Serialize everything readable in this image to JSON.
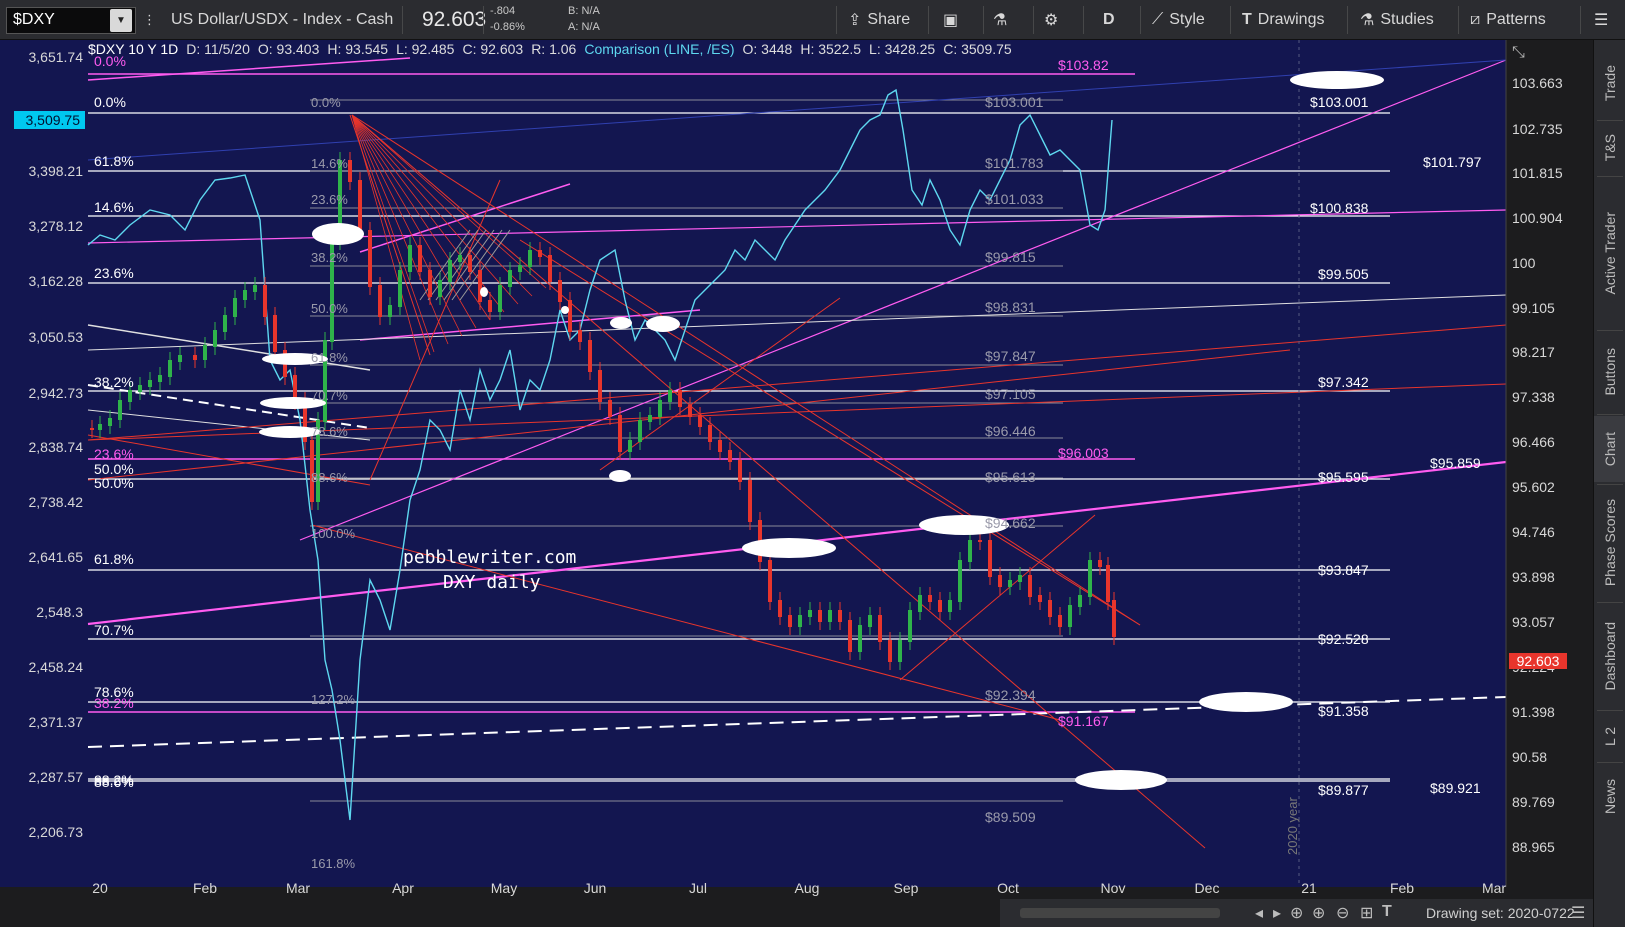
{
  "toolbar": {
    "symbol": "$DXY",
    "title": "US Dollar/USDX - Index - Cash",
    "price": "92.603",
    "change_abs": "-.804",
    "change_pct": "-0.86%",
    "bid": "B: N/A",
    "ask": "A: N/A",
    "share_label": "Share",
    "period_label": "D",
    "style_label": "Style",
    "drawings_label": "Drawings",
    "studies_label": "Studies",
    "patterns_label": "Patterns"
  },
  "chart_header": {
    "study": "$DXY 10 Y 1D",
    "date": "D: 11/5/20",
    "open": "O: 93.403",
    "high": "H: 93.545",
    "low": "L: 92.485",
    "close": "C: 92.603",
    "range": "R: 1.06",
    "comparison": "Comparison (LINE, /ES)",
    "cmp_open": "O: 3448",
    "cmp_high": "H: 3522.5",
    "cmp_low": "L: 3428.25",
    "cmp_close": "C: 3509.75"
  },
  "left_axis": {
    "labels": [
      "3,651.74",
      "3,509.75",
      "3,398.21",
      "3,278.12",
      "3,162.28",
      "3,050.53",
      "2,942.73",
      "2,838.74",
      "2,738.42",
      "2,641.65",
      "2,548.3",
      "2,458.24",
      "2,371.37",
      "2,287.57",
      "2,206.73"
    ],
    "current": "3,509.75"
  },
  "right_axis": {
    "labels": [
      "103.663",
      "102.735",
      "101.815",
      "100.904",
      "100",
      "99.105",
      "98.217",
      "97.338",
      "96.466",
      "95.602",
      "94.746",
      "93.898",
      "93.057",
      "92.224",
      "91.398",
      "90.58",
      "89.769",
      "88.965"
    ],
    "current": "92.603"
  },
  "x_axis": {
    "labels": [
      "20",
      "Feb",
      "Mar",
      "Apr",
      "May",
      "Jun",
      "Jul",
      "Aug",
      "Sep",
      "Oct",
      "Nov",
      "Dec",
      "21",
      "Feb",
      "Mar"
    ],
    "year_marker": "2020 year"
  },
  "fib_left_labels": [
    "0.0%",
    "0.0%",
    "61.8%",
    "14.6%",
    "23.6%",
    "38.2%",
    "23.6%",
    "50.0%",
    "50.0%",
    "61.8%",
    "70.7%",
    "78.6%",
    "38.2%",
    "88.6%",
    "88.2%"
  ],
  "fib_mid_labels": [
    "0.0%",
    "14.6%",
    "23.6%",
    "38.2%",
    "50.0%",
    "61.8%",
    "70.7%",
    "78.6%",
    "88.6%",
    "100.0%",
    "127.2%",
    "161.8%"
  ],
  "fib_price_labels_gray": [
    "$103.001",
    "$101.783",
    "$101.033",
    "$99.815",
    "$98.831",
    "$97.847",
    "$97.105",
    "$96.446",
    "$95.613",
    "$94.662",
    "$92.394",
    "$89.509"
  ],
  "level_labels_white": [
    "$103.001",
    "$101.797",
    "$100.838",
    "$99.505",
    "$97.342",
    "$95.859",
    "$95.595",
    "$93.847",
    "$92.528",
    "$91.358",
    "$89.921",
    "$89.877"
  ],
  "level_labels_magenta": [
    "$103.82",
    "$96.003",
    "$91.167"
  ],
  "watermark": {
    "line1": "pebblewriter.com",
    "line2": "DXY daily"
  },
  "rail_tabs": [
    "Trade",
    "T&S",
    "Active Trader",
    "Buttons",
    "Chart",
    "Phase Scores",
    "Dashboard",
    "L 2",
    "News"
  ],
  "status": {
    "drawing_set": "Drawing set: 2020-0722"
  },
  "colors": {
    "chart_bg": "#131650",
    "up_candle": "#2fb34a",
    "down_candle": "#e8352c",
    "comparison_line": "#5ed8f0",
    "magenta": "#ff5cf0",
    "trend_red": "#e8352c"
  }
}
